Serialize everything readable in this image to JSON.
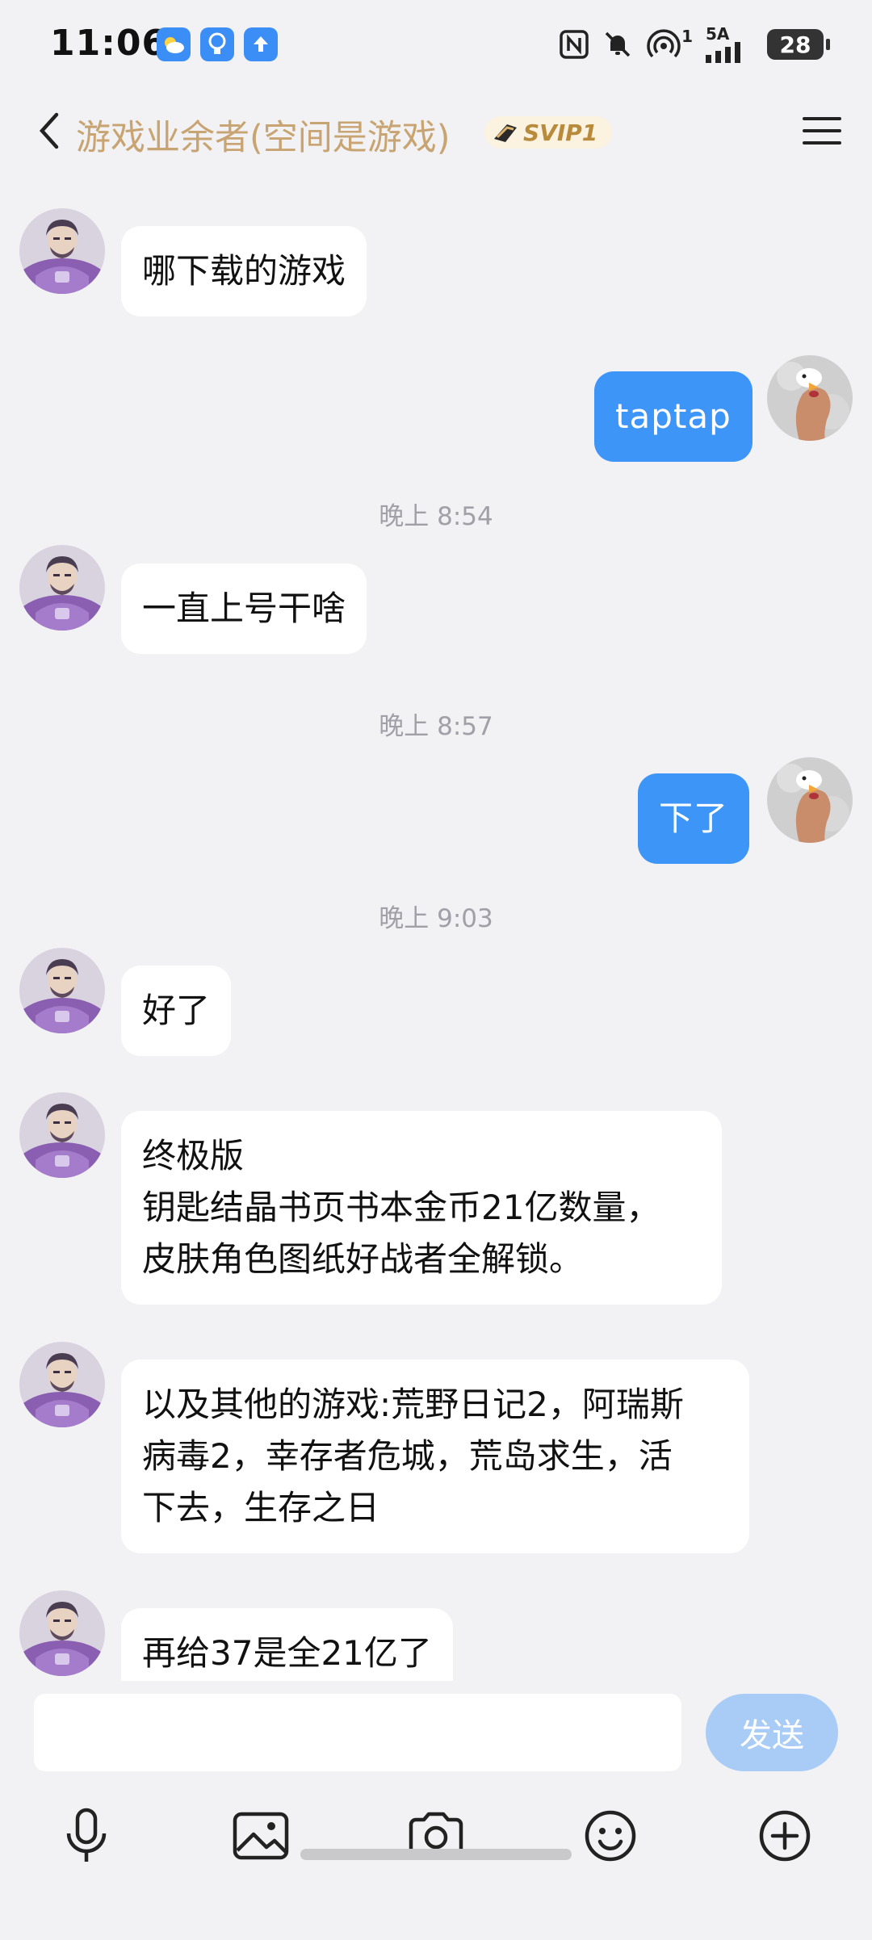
{
  "status_bar": {
    "time": "11:06",
    "net_label_top": "5A",
    "hotspot_count": "1",
    "battery": "28",
    "icons": [
      "weather-icon",
      "bulb-icon",
      "upload-icon",
      "nfc-icon",
      "mute-icon",
      "hotspot-icon",
      "signal-icon",
      "battery-icon"
    ]
  },
  "header": {
    "title": "游戏业余者(空间是游戏)",
    "vip_badge": "SVIP1",
    "back_icon": "chevron-left-icon",
    "menu_icon": "hamburger-menu-icon"
  },
  "messages": [
    {
      "side": "in",
      "text": "哪下载的游戏"
    },
    {
      "side": "out",
      "text": "taptap"
    },
    {
      "type": "time",
      "text": "晚上 8:54"
    },
    {
      "side": "in",
      "text": "一直上号干啥"
    },
    {
      "type": "time",
      "text": "晚上 8:57"
    },
    {
      "side": "out",
      "text": "下了"
    },
    {
      "type": "time",
      "text": "晚上 9:03"
    },
    {
      "side": "in",
      "text": "好了"
    },
    {
      "side": "in",
      "text": "终极版\n钥匙结晶书页书本金币21亿数量，\n皮肤角色图纸好战者全解锁。"
    },
    {
      "side": "in",
      "text": "以及其他的游戏:荒野日记2，阿瑞斯\n病毒2，幸存者危城，荒岛求生，活\n下去，生存之日"
    },
    {
      "side": "in",
      "text": "再给37是全21亿了"
    }
  ],
  "input": {
    "value": "",
    "send_label": "发送"
  },
  "toolbar": {
    "items": [
      "microphone-icon",
      "image-icon",
      "camera-icon",
      "emoji-icon",
      "plus-circle-icon"
    ]
  },
  "colors": {
    "background": "#f2f2f4",
    "title": "#c8a472",
    "outgoing_bubble": "#3d96f7",
    "incoming_bubble": "#ffffff",
    "send_button": "#a9ccf7",
    "timestamp": "#a0a0a6"
  }
}
